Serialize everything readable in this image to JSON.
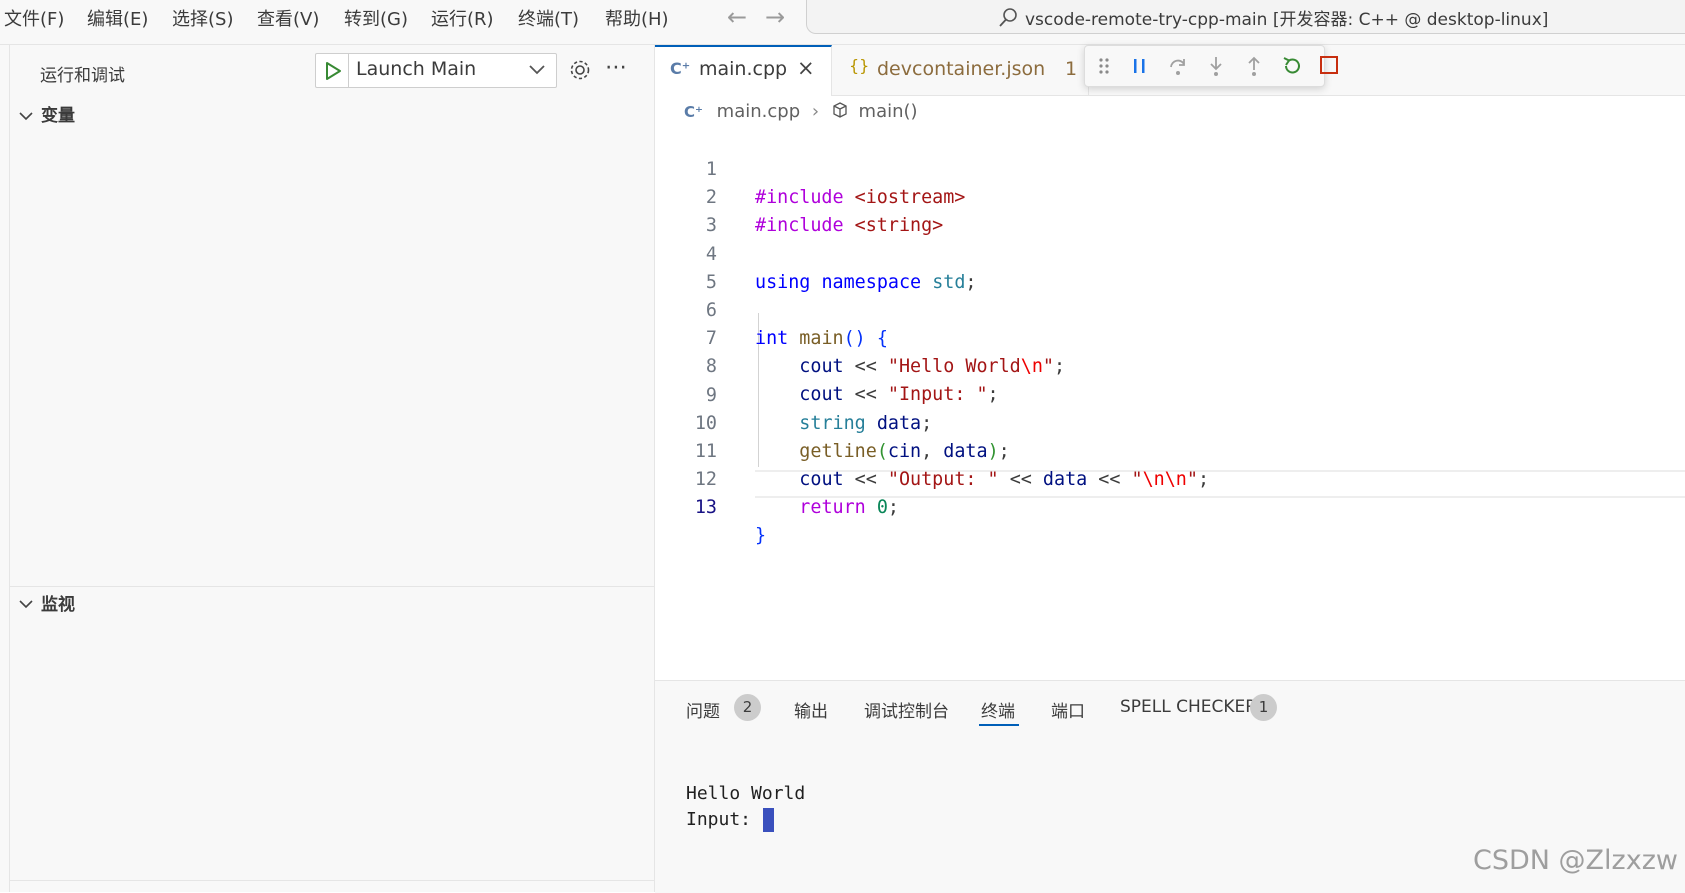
{
  "menu": [
    "文件(F)",
    "编辑(E)",
    "选择(S)",
    "查看(V)",
    "转到(G)",
    "运行(R)",
    "终端(T)",
    "帮助(H)"
  ],
  "command_center": {
    "text": "vscode-remote-try-cpp-main [开发容器: C++ @ desktop-linux]"
  },
  "sidebar": {
    "title": "运行和调试",
    "launch_config": "Launch Main",
    "variables_header": "变量",
    "watch_header": "监视"
  },
  "tabs": [
    {
      "label": "main.cpp",
      "active": true,
      "icon": "cpp-file-icon"
    },
    {
      "label": "devcontainer.json",
      "badge": "1",
      "icon": "json-file-icon"
    }
  ],
  "breadcrumb": {
    "file": "main.cpp",
    "symbol": "main()"
  },
  "editor": {
    "active_line": "13",
    "line_numbers": [
      "1",
      "2",
      "3",
      "4",
      "5",
      "6",
      "7",
      "8",
      "9",
      "10",
      "11",
      "12",
      "13"
    ],
    "lines": [
      "#include <iostream>",
      "#include <string>",
      "",
      "using namespace std;",
      "",
      "int main() {",
      "    cout << \"Hello World\\n\";",
      "    cout << \"Input: \";",
      "    string data;",
      "    getline(cin, data);",
      "    cout << \"Output: \" << data << \"\\n\\n\";",
      "    return 0;",
      "}"
    ]
  },
  "panel": {
    "tabs": [
      {
        "label": "问题",
        "badge": "2"
      },
      {
        "label": "输出"
      },
      {
        "label": "调试控制台"
      },
      {
        "label": "终端",
        "active": true
      },
      {
        "label": "端口"
      },
      {
        "label": "SPELL CHECKER",
        "badge": "1"
      }
    ],
    "terminal": [
      "Hello World",
      "Input: "
    ]
  },
  "watermark": "CSDN @Zlzxzw",
  "colors": {
    "accent": "#005fb8",
    "keyword": "#0000ff",
    "string": "#a31515",
    "preprocessor": "#af00db"
  }
}
